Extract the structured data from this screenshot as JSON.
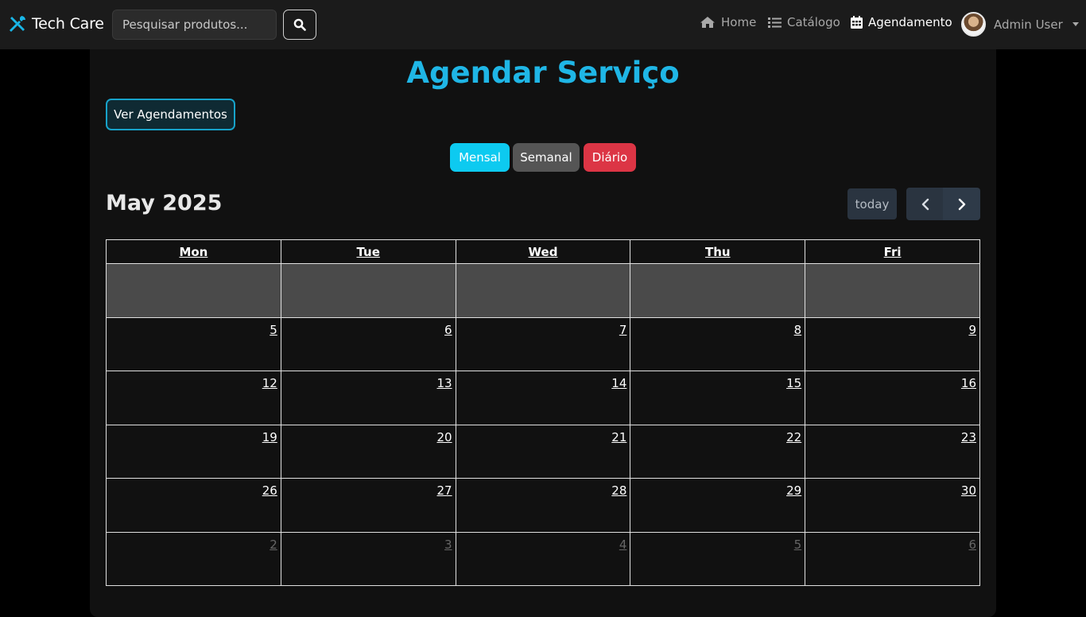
{
  "navbar": {
    "brand": "Tech Care",
    "search_placeholder": "Pesquisar produtos...",
    "links": [
      {
        "label": "Home",
        "icon": "home-icon"
      },
      {
        "label": "Catálogo",
        "icon": "list-icon"
      },
      {
        "label": "Agendamento",
        "icon": "calendar-icon",
        "active": true
      }
    ],
    "user_name": "Admin User"
  },
  "page": {
    "title": "Agendar Serviço",
    "ver_agendamentos": "Ver Agendamentos",
    "views": [
      {
        "label": "Mensal",
        "color": "#0dcaf0"
      },
      {
        "label": "Semanal",
        "color": "#555555"
      },
      {
        "label": "Diário",
        "color": "#dc3545"
      }
    ]
  },
  "calendar": {
    "title": "May 2025",
    "today_label": "today",
    "weekdays": [
      "Mon",
      "Tue",
      "Wed",
      "Thu",
      "Fri"
    ],
    "weeks": [
      [
        {
          "day": ""
        },
        {
          "day": ""
        },
        {
          "day": ""
        },
        {
          "day": ""
        },
        {
          "day": ""
        }
      ],
      [
        {
          "day": "5"
        },
        {
          "day": "6"
        },
        {
          "day": "7"
        },
        {
          "day": "8"
        },
        {
          "day": "9"
        }
      ],
      [
        {
          "day": "12"
        },
        {
          "day": "13"
        },
        {
          "day": "14"
        },
        {
          "day": "15"
        },
        {
          "day": "16"
        }
      ],
      [
        {
          "day": "19"
        },
        {
          "day": "20"
        },
        {
          "day": "21"
        },
        {
          "day": "22"
        },
        {
          "day": "23"
        }
      ],
      [
        {
          "day": "26"
        },
        {
          "day": "27"
        },
        {
          "day": "28"
        },
        {
          "day": "29"
        },
        {
          "day": "30"
        }
      ],
      [
        {
          "day": "2",
          "other": true
        },
        {
          "day": "3",
          "other": true
        },
        {
          "day": "4",
          "other": true
        },
        {
          "day": "5",
          "other": true
        },
        {
          "day": "6",
          "other": true
        }
      ]
    ]
  }
}
